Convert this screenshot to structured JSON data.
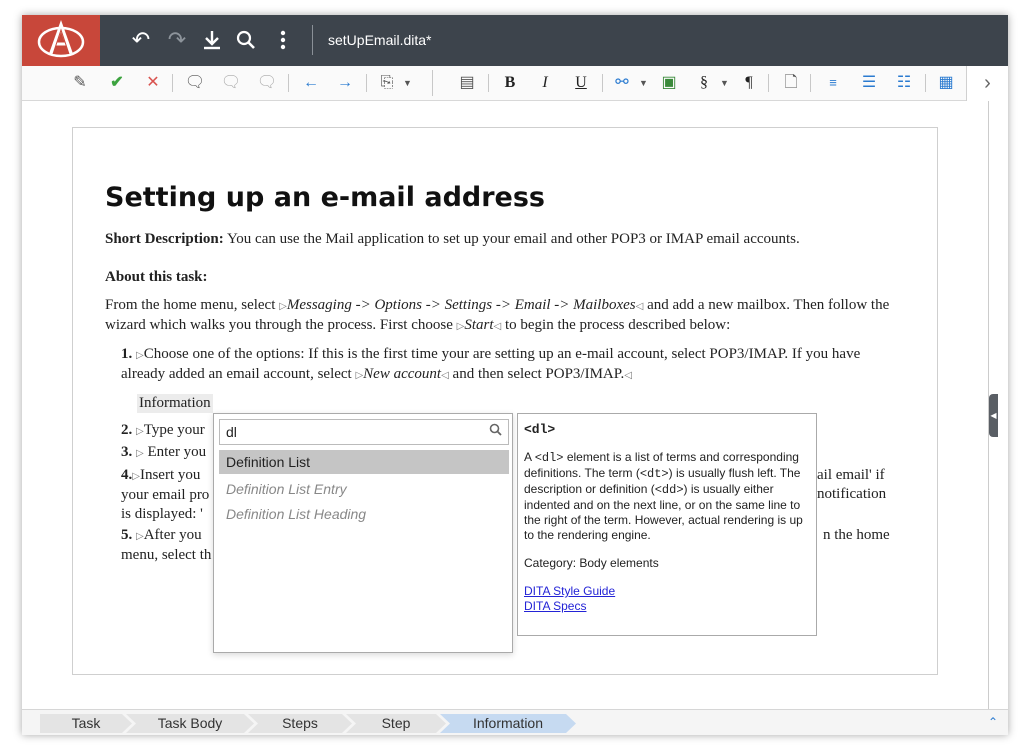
{
  "titlebar": {
    "doc_title": "setUpEmail.dita*",
    "buttons": [
      "undo-icon",
      "redo-icon",
      "download-icon",
      "search-icon",
      "more-vertical-icon"
    ]
  },
  "toolbar": {
    "bold": "B",
    "italic": "I",
    "underline": "U",
    "section": "§",
    "pilcrow": "¶"
  },
  "document": {
    "title": "Setting up an e-mail address",
    "shortdesc_label": "Short Description:",
    "shortdesc_text": "You can use the Mail application to set up your email and other POP3 or IMAP email accounts.",
    "about_label": "About this task:",
    "context_a": "From the home menu, select",
    "context_menu_path": "Messaging -> Options -> Settings -> Email -> Mailboxes",
    "context_b": "and add a new mailbox. Then follow the wizard which walks you through the process. First choose",
    "context_start": "Start",
    "context_c": "to begin the process described below:",
    "step1_num": "1.",
    "step1_a": "Choose one of the options: If this is the first time your are setting up an e-mail account, select POP3/IMAP. If you have already added an email account, select",
    "step1_new": "New account",
    "step1_b": "and then select POP3/IMAP.",
    "info_tag": "Information",
    "step2_num": "2.",
    "step2_text": "Type your",
    "step3_num": "3.",
    "step3_text": "Enter you",
    "step4_num": "4.",
    "step4_text_a": "Insert you",
    "step4_text_b": "your email pro",
    "step4_text_c": "is displayed: '",
    "step4_right_a": "ail email' if",
    "step4_right_b": "notification",
    "step5_num": "5.",
    "step5_text_a": "After you",
    "step5_text_b": "menu, select th",
    "step5_right": "n the home"
  },
  "popup": {
    "search_value": "dl",
    "items": [
      {
        "label": "Definition List",
        "selected": true
      },
      {
        "label": "Definition List Entry",
        "selected": false
      },
      {
        "label": "Definition List Heading",
        "selected": false
      }
    ]
  },
  "doc_panel": {
    "element": "<dl>",
    "desc_a": "A",
    "desc_code1": "<dl>",
    "desc_b": "element is a list of terms and corresponding definitions. The term (",
    "desc_code2": "<dt>",
    "desc_c": ") is usually flush left. The description or definition (",
    "desc_code3": "<dd>",
    "desc_d": ") is usually either indented and on the next line, or on the same line to the right of the term. However, actual rendering is up to the rendering engine.",
    "category": "Category: Body elements",
    "links": [
      "DITA Style Guide",
      "DITA Specs"
    ]
  },
  "breadcrumb": [
    "Task",
    "Task Body",
    "Steps",
    "Step",
    "Information"
  ],
  "colors": {
    "titlebar": "#3d444c",
    "logo": "#c8473a",
    "active_crumb": "#c6daf1"
  }
}
